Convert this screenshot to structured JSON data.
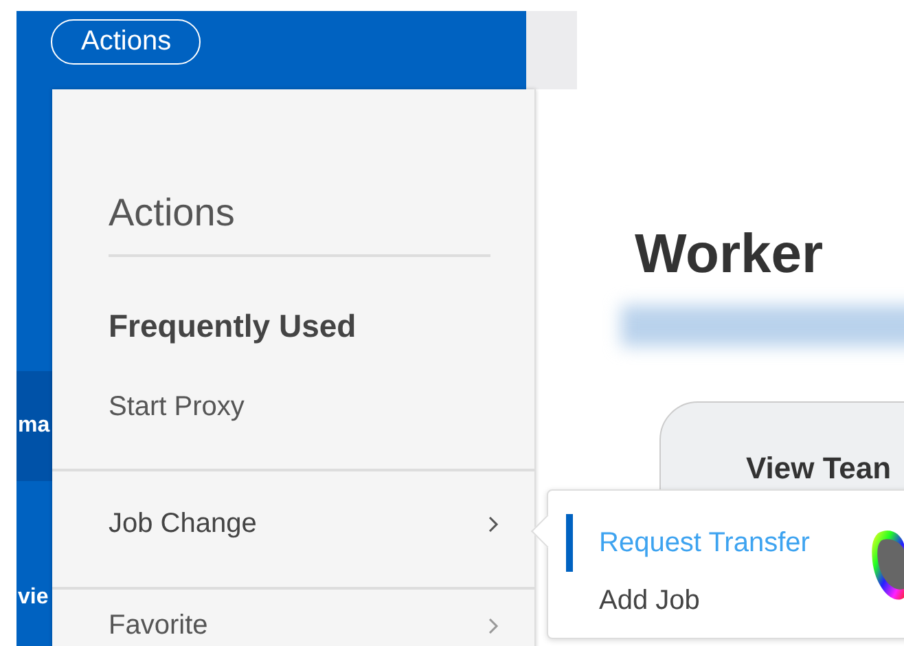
{
  "header": {
    "actions_button": "Actions"
  },
  "sidebar": {
    "items": [
      {
        "label": "ma",
        "selected": true
      },
      {
        "label": "vie",
        "selected": false
      }
    ]
  },
  "actions_menu": {
    "title": "Actions",
    "section_title": "Frequently Used",
    "items": [
      {
        "label": "Start Proxy",
        "kind": "plain"
      },
      {
        "label": "Job Change",
        "kind": "submenu",
        "expanded": true
      },
      {
        "label": "Favorite",
        "kind": "submenu",
        "expanded": false
      }
    ]
  },
  "submenu": {
    "items": [
      {
        "label": "Request Transfer",
        "selected": true
      },
      {
        "label": "Add Job",
        "selected": false
      }
    ]
  },
  "worker": {
    "title": "Worker",
    "view_button": "View Tean"
  }
}
